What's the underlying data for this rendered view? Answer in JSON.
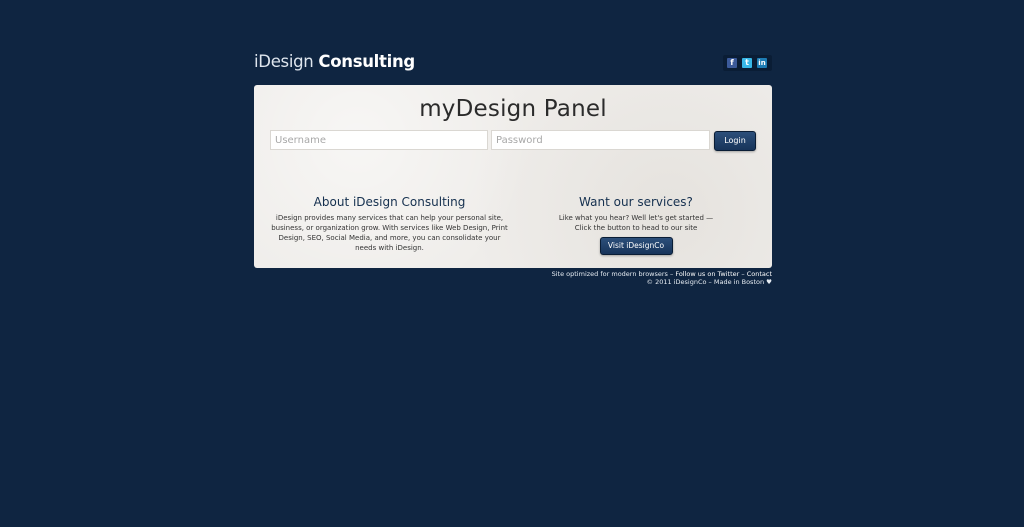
{
  "header": {
    "brand_thin": "iDesign",
    "brand_bold": "Consulting",
    "social": [
      {
        "icon": "facebook-icon",
        "glyph": "f"
      },
      {
        "icon": "twitter-icon",
        "glyph": "t"
      },
      {
        "icon": "linkedin-icon",
        "glyph": "in"
      }
    ]
  },
  "panel": {
    "title": "myDesign Panel",
    "username_placeholder": "Username",
    "password_placeholder": "Password",
    "login_label": "Login"
  },
  "about": {
    "heading": "About iDesign Consulting",
    "body": "iDesign provides many services that can help your personal site, business, or organization grow. With services like Web Design, Print Design, SEO, Social Media, and more, you can consolidate your needs with iDesign."
  },
  "services": {
    "heading": "Want our services?",
    "line1": "Like what you hear? Well let's get started —",
    "line2": "Click the button to head to our site",
    "button_label": "Visit iDesignCo"
  },
  "footer": {
    "note": "Site optimized for modern browsers",
    "sep1": " – ",
    "follow_link": "Follow us on Twitter",
    "sep2": " – ",
    "contact_link": "Contact",
    "copyright": "© 2011 iDesignCo – Made in Boston ♥"
  },
  "colors": {
    "background": "#0f2541",
    "panel": "#efedea",
    "button": "#1f3f66",
    "heading": "#15304f"
  }
}
